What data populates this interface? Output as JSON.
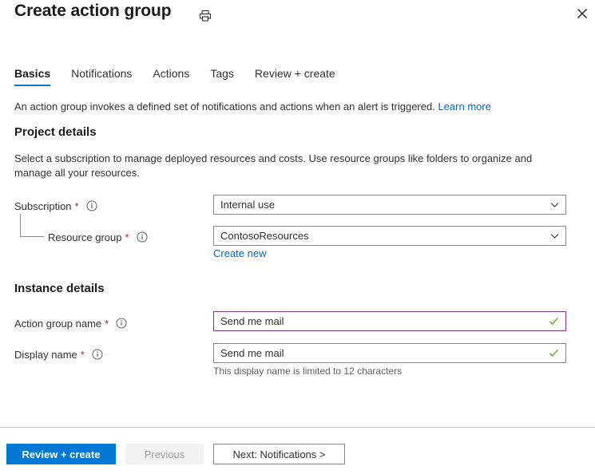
{
  "header": {
    "title": "Create action group",
    "print_icon": "printer-icon",
    "close_icon": "close-icon"
  },
  "tabs": [
    {
      "label": "Basics",
      "active": true
    },
    {
      "label": "Notifications",
      "active": false
    },
    {
      "label": "Actions",
      "active": false
    },
    {
      "label": "Tags",
      "active": false
    },
    {
      "label": "Review + create",
      "active": false
    }
  ],
  "intro": {
    "text": "An action group invokes a defined set of notifications and actions when an alert is triggered.",
    "link_label": "Learn more"
  },
  "project_details": {
    "title": "Project details",
    "description": "Select a subscription to manage deployed resources and costs. Use resource groups like folders to organize and manage all your resources.",
    "fields": [
      {
        "label": "Subscription",
        "required": "*",
        "info_icon": "info-icon",
        "value": "Internal use",
        "control": "dropdown"
      },
      {
        "label": "Resource group",
        "required": "*",
        "info_icon": "info-icon",
        "value": "ContosoResources",
        "control": "dropdown",
        "sub_link": "Create new"
      }
    ]
  },
  "instance_details": {
    "title": "Instance details",
    "fields": [
      {
        "label": "Action group name",
        "required": "*",
        "info_icon": "info-icon",
        "value": "Send me mail",
        "control": "text",
        "valid_icon": "checkmark-icon",
        "focused": true
      },
      {
        "label": "Display name",
        "required": "*",
        "info_icon": "info-icon",
        "value": "Send me mail",
        "control": "text",
        "valid_icon": "checkmark-icon",
        "hint": "This display name is limited to 12 characters",
        "focused": false
      }
    ]
  },
  "footer": {
    "review_create_label": "Review + create",
    "previous_label": "Previous",
    "next_label": "Next: Notifications >"
  },
  "colors": {
    "accent_blue": "#0078d4",
    "link_blue": "#0068c9",
    "required_red": "#a4262c",
    "focus_purple": "#8a3391",
    "valid_green": "#5aab22",
    "border_gray": "#8a8886"
  }
}
